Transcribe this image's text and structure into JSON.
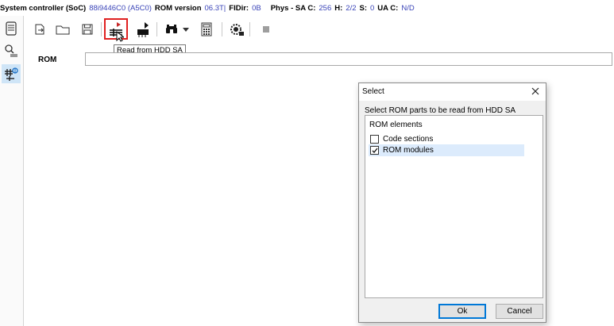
{
  "status": {
    "soc_label": "System controller (SoC)",
    "soc_value": "88i9446C0 (A5C0)",
    "rom_label": "ROM version",
    "rom_value": "06.3T|",
    "fidir_label": "FIDir:",
    "fidir_value": "0B",
    "phys_label": "Phys - SA C:",
    "phys_value": "256",
    "h_label": "H:",
    "h_value": "2/2",
    "s_label": "S:",
    "s_value": "0",
    "ua_label": "UA C:",
    "ua_value": "N/D"
  },
  "sidebar": {
    "items": [
      {
        "icon": "drive-list-icon"
      },
      {
        "icon": "search-tools-icon"
      },
      {
        "icon": "plugins-icon",
        "active": true
      }
    ]
  },
  "toolbar": {
    "buttons": [
      {
        "icon": "export-icon"
      },
      {
        "icon": "open-folder-icon"
      },
      {
        "icon": "save-icon"
      },
      {
        "icon": "read-from-hdd-sa-icon",
        "selected": true
      },
      {
        "icon": "read-chip-icon"
      },
      {
        "icon": "binoculars-icon"
      },
      {
        "icon": "dropdown-arrow-icon"
      },
      {
        "icon": "calculator-icon"
      },
      {
        "icon": "settings-chip-icon"
      },
      {
        "icon": "stop-icon"
      }
    ],
    "tooltip": "Read from HDD SA"
  },
  "main": {
    "rom_label": "ROM",
    "rom_value": ""
  },
  "dialog": {
    "title": "Select",
    "prompt": "Select ROM parts to be read from HDD SA",
    "tree_header": "ROM elements",
    "items": [
      {
        "label": "Code sections",
        "checked": false
      },
      {
        "label": "ROM modules",
        "checked": true
      }
    ],
    "ok_label": "Ok",
    "cancel_label": "Cancel"
  },
  "colors": {
    "accent_blue": "#3a44b8",
    "selection_red": "#e02020",
    "highlight": "#dcebfc"
  }
}
